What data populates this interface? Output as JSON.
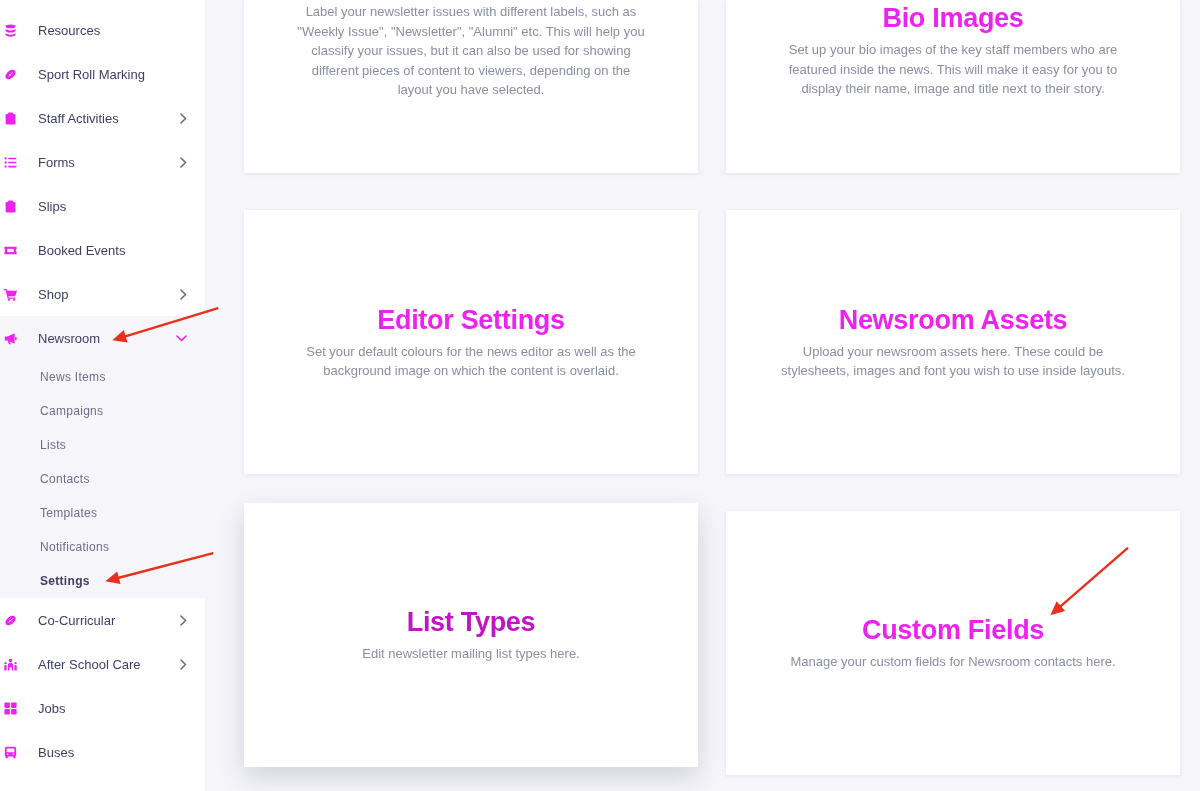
{
  "sidebar": {
    "items": [
      {
        "label": "Resources",
        "kind": "link",
        "expanded": false,
        "pointer_arrow": false
      },
      {
        "label": "Sport Roll Marking",
        "kind": "link",
        "expanded": false,
        "pointer_arrow": false
      },
      {
        "label": "Staff Activities",
        "kind": "group",
        "expanded": false,
        "pointer_arrow": false
      },
      {
        "label": "Forms",
        "kind": "group",
        "expanded": false,
        "pointer_arrow": false
      },
      {
        "label": "Slips",
        "kind": "link",
        "expanded": false,
        "pointer_arrow": false
      },
      {
        "label": "Booked Events",
        "kind": "link",
        "expanded": false,
        "pointer_arrow": false
      },
      {
        "label": "Shop",
        "kind": "group",
        "expanded": false,
        "pointer_arrow": false
      },
      {
        "label": "Newsroom",
        "kind": "group",
        "expanded": true,
        "pointer_arrow": true,
        "children": [
          {
            "label": "News Items",
            "selected": false,
            "pointer_arrow": false
          },
          {
            "label": "Campaigns",
            "selected": false,
            "pointer_arrow": false
          },
          {
            "label": "Lists",
            "selected": false,
            "pointer_arrow": false
          },
          {
            "label": "Contacts",
            "selected": false,
            "pointer_arrow": false
          },
          {
            "label": "Templates",
            "selected": false,
            "pointer_arrow": false
          },
          {
            "label": "Notifications",
            "selected": false,
            "pointer_arrow": false
          },
          {
            "label": "Settings",
            "selected": true,
            "pointer_arrow": true
          }
        ]
      },
      {
        "label": "Co-Curricular",
        "kind": "group",
        "expanded": false,
        "pointer_arrow": false
      },
      {
        "label": "After School Care",
        "kind": "group",
        "expanded": false,
        "pointer_arrow": false
      },
      {
        "label": "Jobs",
        "kind": "link",
        "expanded": false,
        "pointer_arrow": false
      },
      {
        "label": "Buses",
        "kind": "link",
        "expanded": false,
        "pointer_arrow": false
      }
    ]
  },
  "cards": [
    {
      "description": "Label your newsletter issues with different labels, such as \"Weekly Issue\", \"Newsletter\", \"Alumni\" etc. This will help you classify your issues, but it can also be used for showing different pieces of content to viewers, depending on the layout you have selected.",
      "hovered": false,
      "pointer_arrow": false
    },
    {
      "title": "Bio Images",
      "description": "Set up your bio images of the key staff members who are featured inside the news. This will make it easy for you to display their name, image and title next to their story.",
      "hovered": false,
      "pointer_arrow": false
    },
    {
      "title": "Editor Settings",
      "description": "Set your default colours for the news editor as well as the background image on which the content is overlaid.",
      "hovered": false,
      "pointer_arrow": false
    },
    {
      "title": "Newsroom Assets",
      "description": "Upload your newsroom assets here. These could be stylesheets, images and font you wish to use inside layouts.",
      "hovered": false,
      "pointer_arrow": false
    },
    {
      "title": "List Types",
      "description": "Edit newsletter mailing list types here.",
      "hovered": true,
      "pointer_arrow": false
    },
    {
      "title": "Custom Fields",
      "description": "Manage your custom fields for Newsroom contacts here.",
      "hovered": false,
      "pointer_arrow": true
    }
  ]
}
